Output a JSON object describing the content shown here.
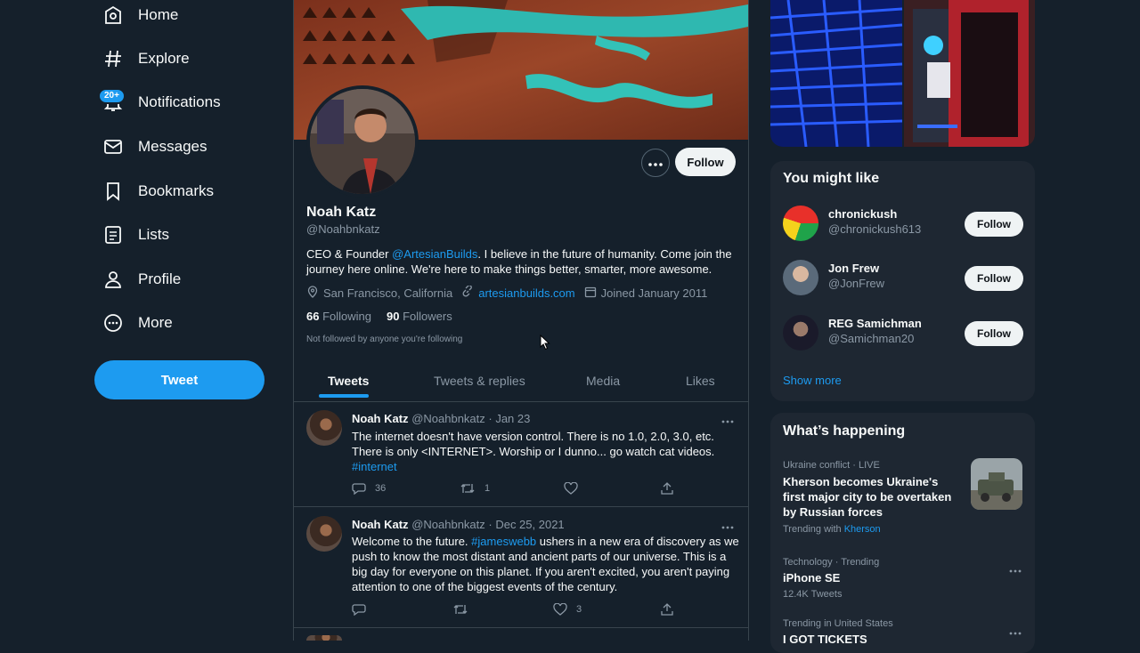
{
  "nav": {
    "items": [
      {
        "label": "Home",
        "icon": "home-icon"
      },
      {
        "label": "Explore",
        "icon": "hashtag-icon"
      },
      {
        "label": "Notifications",
        "icon": "bell-icon"
      },
      {
        "label": "Messages",
        "icon": "envelope-icon"
      },
      {
        "label": "Bookmarks",
        "icon": "bookmark-icon"
      },
      {
        "label": "Lists",
        "icon": "list-icon"
      },
      {
        "label": "Profile",
        "icon": "person-icon"
      },
      {
        "label": "More",
        "icon": "more-circle-icon"
      }
    ],
    "notifications_badge": "20+",
    "tweet_button": "Tweet"
  },
  "profile": {
    "name": "Noah Katz",
    "handle": "@Noahbnkatz",
    "bio_prefix": "CEO & Founder ",
    "bio_mention": "@ArtesianBuilds",
    "bio_suffix": ". I believe in the future of humanity. Come join the journey here online. We're here to make things better, smarter, more awesome.",
    "location": "San Francisco, California",
    "website": "artesianbuilds.com",
    "joined": "Joined January 2011",
    "following_count": "66",
    "following_label": "Following",
    "followers_count": "90",
    "followers_label": "Followers",
    "not_followed": "Not followed by anyone you're following",
    "follow_button": "Follow"
  },
  "tabs": [
    {
      "label": "Tweets",
      "active": true
    },
    {
      "label": "Tweets & replies",
      "active": false
    },
    {
      "label": "Media",
      "active": false
    },
    {
      "label": "Likes",
      "active": false
    }
  ],
  "tweets": [
    {
      "name": "Noah Katz",
      "handle": "@Noahbnkatz",
      "date": "· Jan 23",
      "text_line1": "The internet doesn't have version control. There is no 1.0, 2.0, 3.0, etc.",
      "text_line2": "There is only <INTERNET>. Worship or I dunno... go watch cat videos.",
      "hashtag": "#internet",
      "replies": "36",
      "retweets": "1",
      "likes": ""
    },
    {
      "name": "Noah Katz",
      "handle": "@Noahbnkatz",
      "date": "· Dec 25, 2021",
      "text_prefix": "Welcome to the future. ",
      "hashtag": "#jameswebb",
      "text_suffix": " ushers in a new era of discovery as we push to know the most distant and ancient parts of our universe. This is a big day for everyone on this planet. If you aren't excited, you aren't paying attention to one of the biggest events of the century.",
      "replies": "",
      "retweets": "",
      "likes": "3"
    }
  ],
  "sidebar": {
    "you_might_like_title": "You might like",
    "suggestions": [
      {
        "name": "chronickush",
        "handle": "@chronickush613",
        "button": "Follow"
      },
      {
        "name": "Jon Frew",
        "handle": "@JonFrew",
        "button": "Follow"
      },
      {
        "name": "REG Samichman",
        "handle": "@Samichman20",
        "button": "Follow"
      }
    ],
    "show_more": "Show more",
    "whats_happening_title": "What’s happening",
    "trends": [
      {
        "meta": "Ukraine conflict · LIVE",
        "title": "Kherson becomes Ukraine's first major city to be overtaken by Russian forces",
        "trending_with_label": "Trending with",
        "trending_with_link": "Kherson"
      },
      {
        "meta": "Technology · Trending",
        "title": "iPhone SE",
        "count": "12.4K Tweets"
      },
      {
        "meta": "Trending in United States",
        "title": "I GOT TICKETS"
      }
    ]
  },
  "colors": {
    "background": "#15202b",
    "accent": "#1d9bf0",
    "card": "#1e2732",
    "muted": "#8b98a5"
  }
}
